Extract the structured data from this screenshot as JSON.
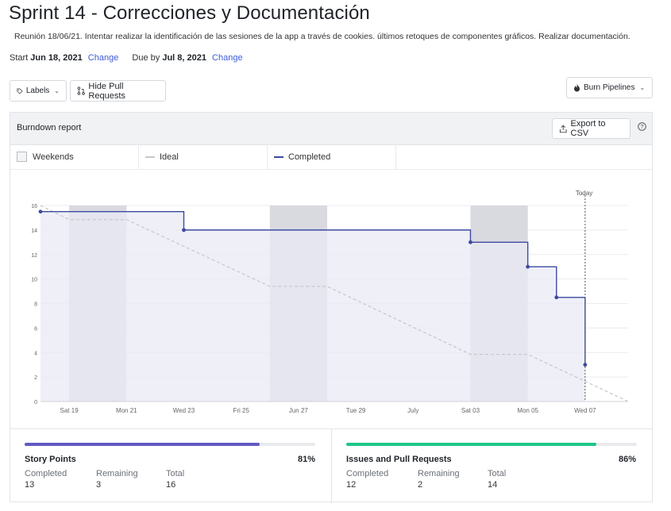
{
  "header": {
    "title": "Sprint 14 - Correcciones y Documentación",
    "description": "Reunión 18/06/21. Intentar realizar la identificación de las sesiones de la app a través de cookies. últimos retoques de componentes gráficos. Realizar documentación.",
    "start_label": "Start",
    "start_date": "Jun 18, 2021",
    "due_label": "Due by",
    "due_date": "Jul 8, 2021",
    "change_label": "Change"
  },
  "toolbar": {
    "labels": "Labels",
    "hide_pr": "Hide Pull Requests",
    "burn_pipelines": "Burn Pipelines"
  },
  "report": {
    "title": "Burndown report",
    "export": "Export to CSV",
    "help_icon": "question-circle-icon",
    "legend": {
      "weekends": "Weekends",
      "ideal": "Ideal",
      "completed": "Completed"
    }
  },
  "colors": {
    "completed": "#3d4a9e",
    "ideal": "#c6c6cc",
    "area": "#e9eaf6",
    "weekend": "#d9d9e0",
    "story_bar": "#6259c4",
    "issues_bar": "#1fc68a"
  },
  "chart_data": {
    "type": "line",
    "x_ticks": [
      "Sat 19",
      "Mon 21",
      "Wed 23",
      "Fri 25",
      "Jun 27",
      "Tue 29",
      "July",
      "Sat 03",
      "Mon 05",
      "Wed 07"
    ],
    "y_ticks": [
      0,
      2,
      4,
      6,
      8,
      10,
      12,
      14,
      16
    ],
    "ylim": [
      0,
      16
    ],
    "today_label": "Today",
    "weekends": [
      [
        19,
        21
      ],
      [
        26,
        28
      ],
      [
        33,
        35
      ]
    ],
    "series": [
      {
        "name": "Completed",
        "step": true,
        "points": [
          [
            18.0,
            15.5
          ],
          [
            23.0,
            14
          ],
          [
            33.0,
            13
          ],
          [
            35.0,
            11
          ],
          [
            36.0,
            8.5
          ],
          [
            37.0,
            3
          ]
        ]
      },
      {
        "name": "Ideal",
        "dashed": true,
        "points": [
          [
            18.0,
            16
          ],
          [
            19.0,
            14.85
          ],
          [
            21.0,
            14.85
          ],
          [
            26.0,
            9.4
          ],
          [
            28.0,
            9.4
          ],
          [
            33.0,
            3.85
          ],
          [
            35.0,
            3.85
          ],
          [
            38.5,
            0
          ]
        ]
      }
    ],
    "today_x": 37.0
  },
  "stats": {
    "story": {
      "name": "Story Points",
      "pct": "81%",
      "fill": 0.81,
      "completed_label": "Completed",
      "completed": "13",
      "remaining_label": "Remaining",
      "remaining": "3",
      "total_label": "Total",
      "total": "16"
    },
    "issues": {
      "name": "Issues and Pull Requests",
      "pct": "86%",
      "fill": 0.86,
      "completed_label": "Completed",
      "completed": "12",
      "remaining_label": "Remaining",
      "remaining": "2",
      "total_label": "Total",
      "total": "14"
    }
  }
}
